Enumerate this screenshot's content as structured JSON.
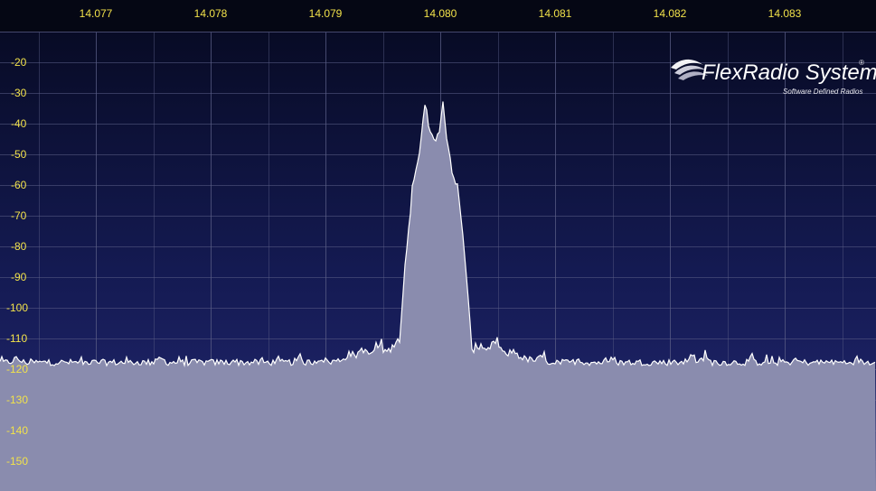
{
  "panadapter": {
    "frequency_labels": [
      "14.077",
      "14.078",
      "14.079",
      "14.080",
      "14.081",
      "14.082",
      "14.083"
    ],
    "db_labels": [
      "-20",
      "-30",
      "-40",
      "-50",
      "-60",
      "-70",
      "-80",
      "-90",
      "-100",
      "-110",
      "-120",
      "-130",
      "-140",
      "-150"
    ]
  },
  "logo": {
    "brand": "FlexRadio Systems",
    "registered_mark": "®",
    "tagline": "Software Defined Radios"
  },
  "colors": {
    "background_top": "#06091f",
    "background_bottom": "#1e2266",
    "grid": "#5a5e86",
    "trace_fill": "#8a8cae",
    "trace_line": "#ffffff",
    "label": "#f2e24a"
  }
}
